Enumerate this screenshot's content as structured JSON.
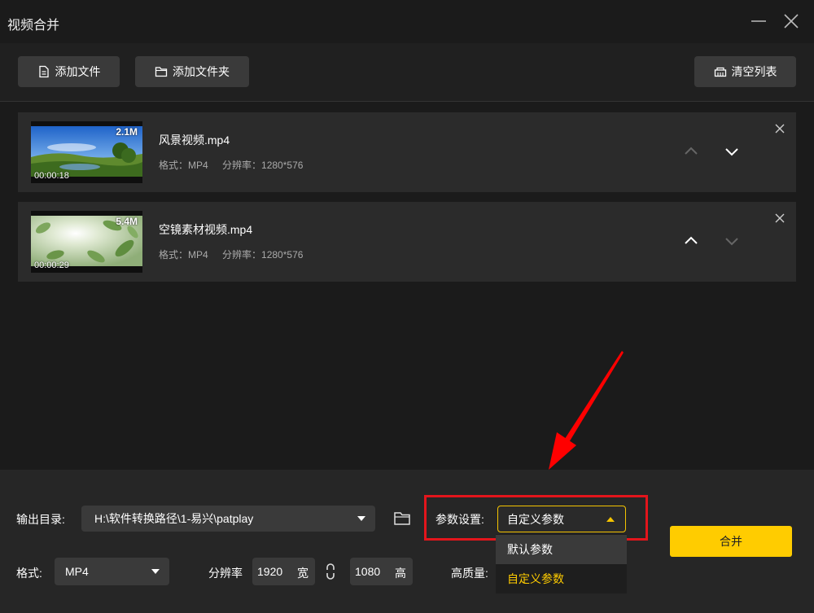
{
  "window": {
    "title": "视频合并"
  },
  "toolbar": {
    "add_file_label": "添加文件",
    "add_folder_label": "添加文件夹",
    "clear_list_label": "清空列表"
  },
  "files": [
    {
      "name": "风景视频.mp4",
      "size": "2.1M",
      "duration": "00:00:18",
      "format": "格式：MP4",
      "resolution": "分辨率：1280*576"
    },
    {
      "name": "空镜素材视频.mp4",
      "size": "5.4M",
      "duration": "00:00:29",
      "format": "格式：MP4",
      "resolution": "分辨率：1280*576"
    }
  ],
  "output": {
    "dir_label": "输出目录:",
    "dir_value": "H:\\软件转换路径\\1-易兴\\patplay"
  },
  "params": {
    "label": "参数设置:",
    "selected": "自定义参数",
    "options": [
      "默认参数",
      "自定义参数"
    ]
  },
  "format": {
    "label": "格式:",
    "value": "MP4"
  },
  "resolution": {
    "label": "分辨率",
    "width": "1920",
    "width_unit": "宽",
    "height": "1080",
    "height_unit": "高"
  },
  "quality": {
    "label": "高质量:"
  },
  "merge_label": "合并",
  "colors": {
    "accent": "#ffcc00",
    "highlight": "#e3151c",
    "annotation_arrow": "#ff0000"
  }
}
